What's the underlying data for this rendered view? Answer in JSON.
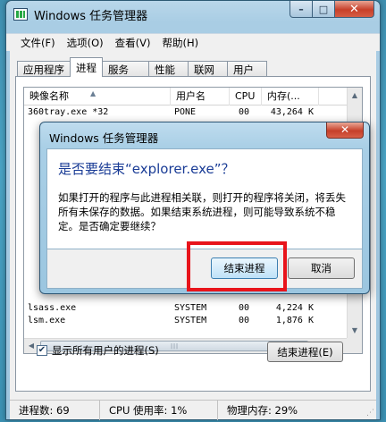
{
  "window": {
    "title": "Windows 任务管理器",
    "minimize_label": "–",
    "maximize_label": "□",
    "close_label": "✕"
  },
  "menu": [
    "文件(F)",
    "选项(O)",
    "查看(V)",
    "帮助(H)"
  ],
  "tabs": [
    "应用程序",
    "进程",
    "服务",
    "性能",
    "联网",
    "用户"
  ],
  "active_tab": "进程",
  "columns": [
    "映像名称",
    "用户名",
    "CPU",
    "内存(..."
  ],
  "rows_top": [
    {
      "name": "360tray.exe *32",
      "user": "PONE",
      "cpu": "00",
      "mem": "43,264 K"
    }
  ],
  "rows_bottom": [
    {
      "name": "lsass.exe",
      "user": "SYSTEM",
      "cpu": "00",
      "mem": "4,224 K"
    },
    {
      "name": "lsm.exe",
      "user": "SYSTEM",
      "cpu": "00",
      "mem": "1,876 K"
    }
  ],
  "show_all_users": {
    "label": "显示所有用户的进程(S)",
    "checked": true
  },
  "end_process_button": "结束进程(E)",
  "status": {
    "processes": "进程数: 69",
    "cpu": "CPU 使用率: 1%",
    "memory": "物理内存: 29%"
  },
  "dialog": {
    "title": "Windows 任务管理器",
    "heading": "是否要结束“explorer.exe”？",
    "message": "如果打开的程序与此进程相关联，则打开的程序将关闭，将丢失所有未保存的数据。如果结束系统进程，则可能导致系统不稳定。是否确定要继续？",
    "confirm_label": "结束进程",
    "cancel_label": "取消",
    "close_label": "✕"
  },
  "colors": {
    "highlight": "#e8141b",
    "heading": "#1a3c96"
  }
}
